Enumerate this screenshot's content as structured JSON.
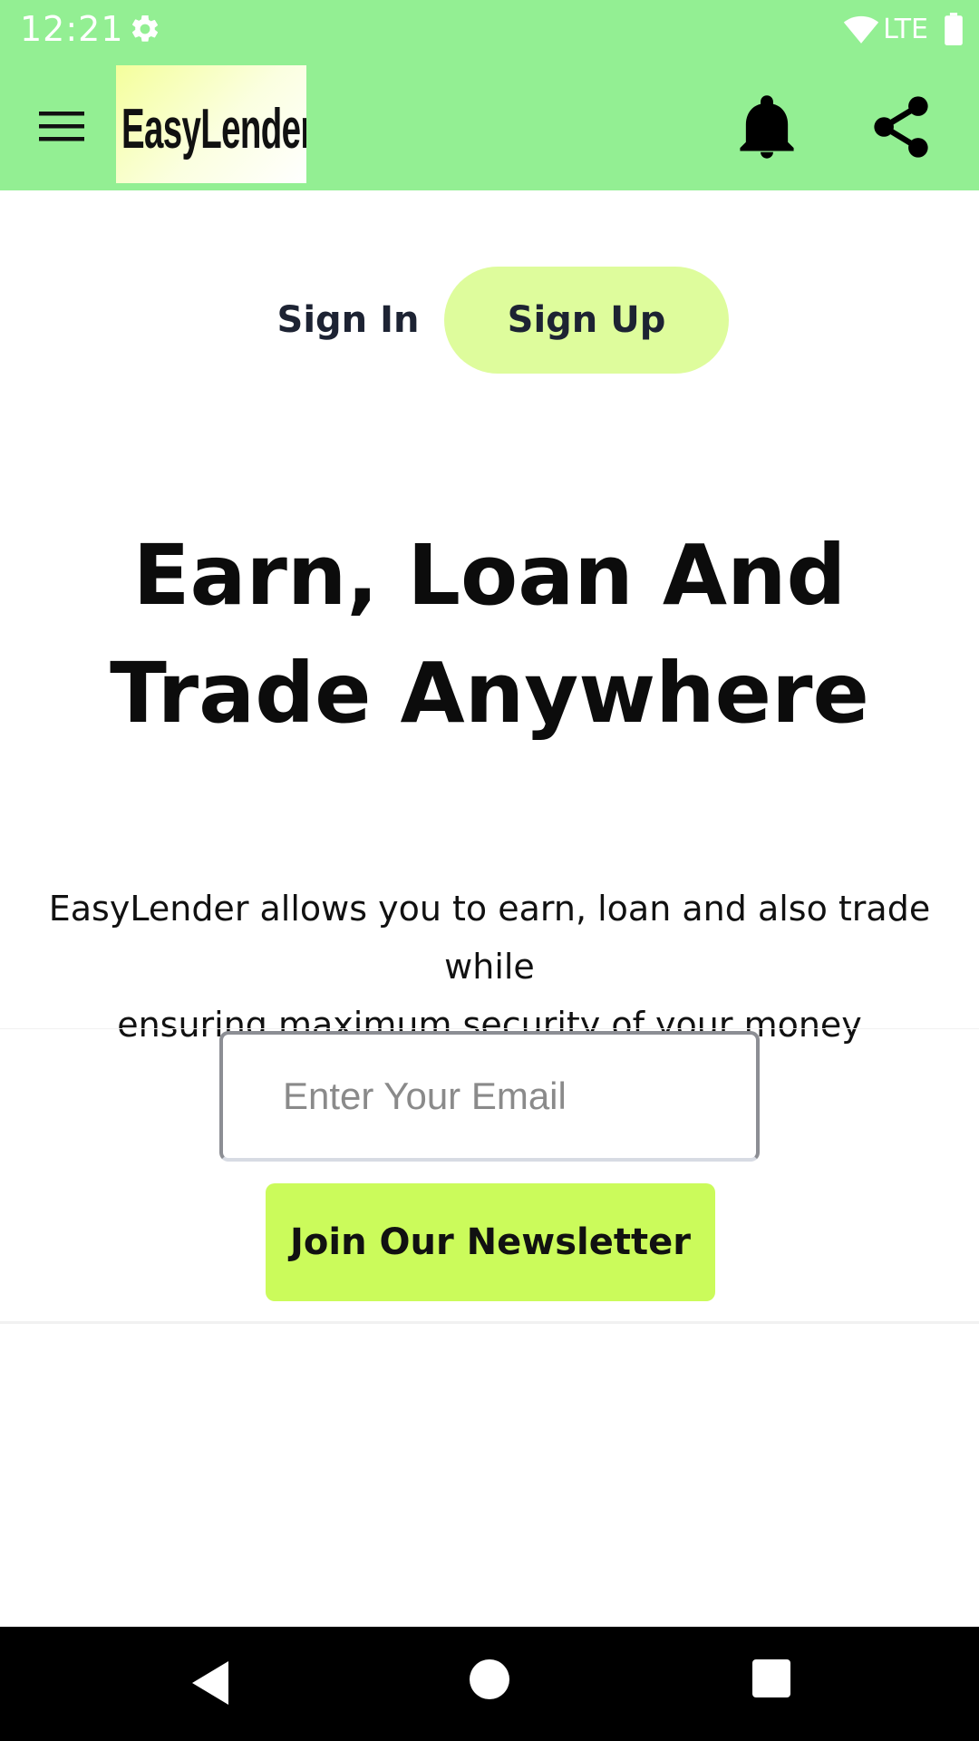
{
  "status_bar": {
    "time": "12:21",
    "network_label": "LTE",
    "icons": [
      "gear-icon",
      "wifi-icon",
      "battery-icon"
    ]
  },
  "app_bar": {
    "background_color": "#93ef93",
    "logo_text": "EasyLender",
    "icons": [
      "menu-icon",
      "bell-icon",
      "share-icon"
    ]
  },
  "auth_tabs": {
    "sign_in": "Sign In",
    "sign_up": "Sign Up",
    "active_color": "#defc9c"
  },
  "hero": {
    "title_line1": "Earn, Loan And",
    "title_line2": "Trade Anywhere",
    "description_line1": "EasyLender allows you to earn, loan and also trade while",
    "description_line2": "ensuring maximum security of your money"
  },
  "newsletter": {
    "email_value": "",
    "email_placeholder": "Enter Your Email",
    "button_label": "Join Our Newsletter",
    "button_color": "#cbfb5b"
  },
  "nav_bar": {
    "icons": [
      "back-icon",
      "home-icon",
      "recents-icon"
    ]
  }
}
